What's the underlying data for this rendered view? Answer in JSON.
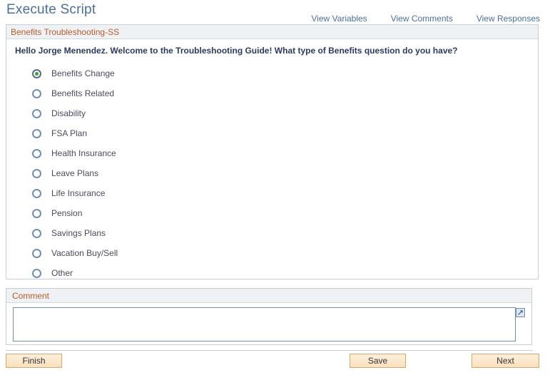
{
  "header": {
    "title": "Execute Script",
    "links": [
      {
        "label": "View Variables",
        "name": "view-variables"
      },
      {
        "label": "View Comments",
        "name": "view-comments"
      },
      {
        "label": "View Responses",
        "name": "view-responses"
      }
    ]
  },
  "main_panel": {
    "group_label": "Benefits Troubleshooting-SS",
    "question": "Hello Jorge Menendez. Welcome to the Troubleshooting Guide! What type of Benefits question do you have?",
    "options": [
      {
        "label": "Benefits Change",
        "selected": true
      },
      {
        "label": "Benefits Related",
        "selected": false
      },
      {
        "label": "Disability",
        "selected": false
      },
      {
        "label": "FSA Plan",
        "selected": false
      },
      {
        "label": "Health Insurance",
        "selected": false
      },
      {
        "label": "Leave Plans",
        "selected": false
      },
      {
        "label": "Life Insurance",
        "selected": false
      },
      {
        "label": "Pension",
        "selected": false
      },
      {
        "label": "Savings Plans",
        "selected": false
      },
      {
        "label": "Vacation Buy/Sell",
        "selected": false
      },
      {
        "label": "Other",
        "selected": false
      }
    ]
  },
  "comment_panel": {
    "group_label": "Comment",
    "textarea_value": "",
    "textarea_placeholder": "",
    "expand_icon": "expand-arrow-icon"
  },
  "buttons": {
    "finish": "Finish",
    "save": "Save",
    "next": "Next"
  },
  "colors": {
    "title_blue": "#4a6fa5",
    "group_label_orange": "#c05a2a",
    "question_navy": "#2b3a67",
    "radio_ring": "#6f8fb5",
    "radio_selected_dot": "#2ea82e",
    "button_fill": "#f9e0bd",
    "button_border": "#d4a96a",
    "panel_border": "#c8cdd2",
    "group_header_bg": "#eef2f4"
  }
}
